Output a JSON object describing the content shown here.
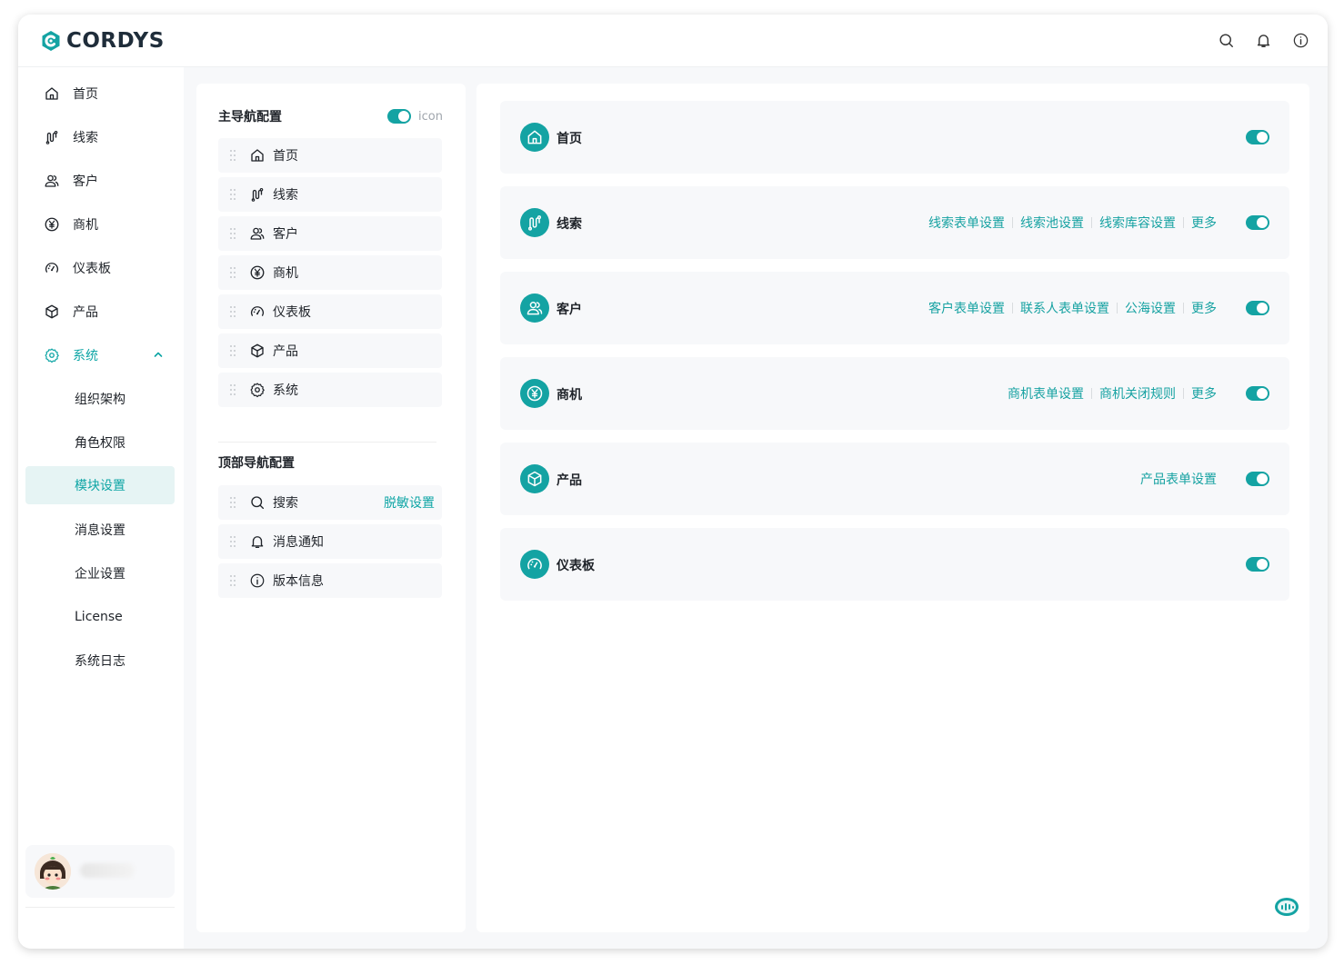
{
  "app": {
    "logo_text": "CORDYS",
    "brand_color": "#14a3a3"
  },
  "topbar": {
    "icons": [
      "search-icon",
      "bell-icon",
      "info-icon"
    ]
  },
  "sidebar": {
    "items": [
      {
        "label": "首页",
        "icon": "home-icon"
      },
      {
        "label": "线索",
        "icon": "lead-icon"
      },
      {
        "label": "客户",
        "icon": "customer-icon"
      },
      {
        "label": "商机",
        "icon": "yen-icon"
      },
      {
        "label": "仪表板",
        "icon": "dashboard-icon"
      },
      {
        "label": "产品",
        "icon": "box-icon"
      },
      {
        "label": "系统",
        "icon": "gear-icon",
        "expanded": true
      }
    ],
    "sub_items": [
      {
        "label": "组织架构"
      },
      {
        "label": "角色权限"
      },
      {
        "label": "模块设置",
        "active": true
      },
      {
        "label": "消息设置"
      },
      {
        "label": "企业设置"
      },
      {
        "label": "License"
      },
      {
        "label": "系统日志"
      }
    ]
  },
  "main_nav_config": {
    "title": "主导航配置",
    "icon_toggle_label": "icon",
    "icon_toggle_on": true,
    "rows": [
      {
        "label": "首页",
        "icon": "home-icon"
      },
      {
        "label": "线索",
        "icon": "lead-icon"
      },
      {
        "label": "客户",
        "icon": "customer-icon"
      },
      {
        "label": "商机",
        "icon": "yen-icon"
      },
      {
        "label": "仪表板",
        "icon": "dashboard-icon"
      },
      {
        "label": "产品",
        "icon": "box-icon"
      },
      {
        "label": "系统",
        "icon": "gear-icon"
      }
    ]
  },
  "top_nav_config": {
    "title": "顶部导航配置",
    "rows": [
      {
        "label": "搜索",
        "icon": "search-icon",
        "link": "脱敏设置"
      },
      {
        "label": "消息通知",
        "icon": "bell-icon"
      },
      {
        "label": "版本信息",
        "icon": "info-icon"
      }
    ]
  },
  "modules": [
    {
      "title": "首页",
      "icon": "home-icon",
      "links": [],
      "enabled": true
    },
    {
      "title": "线索",
      "icon": "lead-icon",
      "links": [
        "线索表单设置",
        "线索池设置",
        "线索库容设置",
        "更多"
      ],
      "enabled": true
    },
    {
      "title": "客户",
      "icon": "customer-icon",
      "links": [
        "客户表单设置",
        "联系人表单设置",
        "公海设置",
        "更多"
      ],
      "enabled": true
    },
    {
      "title": "商机",
      "icon": "yen-icon",
      "links": [
        "商机表单设置",
        "商机关闭规则",
        "更多"
      ],
      "enabled": true
    },
    {
      "title": "产品",
      "icon": "box-icon",
      "links": [
        "产品表单设置"
      ],
      "enabled": true
    },
    {
      "title": "仪表板",
      "icon": "dashboard-icon",
      "links": [],
      "enabled": true
    }
  ]
}
